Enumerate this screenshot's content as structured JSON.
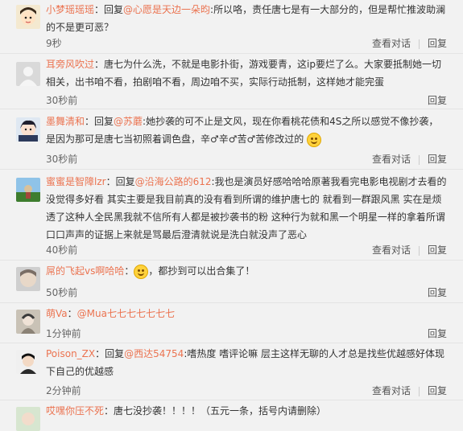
{
  "ops": {
    "view_label": "查看对话",
    "reply_label": "回复"
  },
  "comments": [
    {
      "user": "小梦瑶瑶瑶",
      "prefix": "：回复",
      "mention": "@心愿是天边一朵昀",
      "content": ":所以咯，责任唐七是有一大部分的，但是帮忙推波助澜的不是更可恶？",
      "time": "9秒",
      "has_view": true
    },
    {
      "user": "耳旁风吹过",
      "prefix": "：",
      "mention": "",
      "content": "唐七为什么洗，不就是电影扑街，游戏要青，这ip要烂了么。大家要抵制她一切相关，出书咱不看，拍剧咱不看，周边咱不买，实际行动抵制，这样她才能完蛋",
      "time": "30秒前",
      "has_view": false
    },
    {
      "user": "墨舞清和",
      "prefix": "：回复",
      "mention": "@苏蘑",
      "content": ":她抄袭的可不止是文风，现在你看桃花债和4S之所以感觉不像抄袭，是因为那可是唐七当初照着调色盘，辛♂辛♂苦♂苦修改过的",
      "time": "30秒前",
      "has_view": true
    },
    {
      "user": "蜜蜜是智障lzr",
      "prefix": "：回复",
      "mention": "@沿海公路的612",
      "content": ":我也是演员好感哈哈哈原著我看完电影电视剧才去看的没觉得多好看 其实主要是我目前真的没有看到所谓的维护唐七的 就看到一群跟风黑 实在是烦透了这种人全民黑我就不信所有人都是被抄袭书的粉 这种行为就和黑一个明星一样的拿着所谓口口声声的证据上来就是骂最后澄清就说是洗白就没声了恶心",
      "time": "40秒前",
      "has_view": true
    },
    {
      "user": "屌的飞起vs啊哈哈",
      "prefix": "：",
      "mention": "",
      "content": "，都抄到可以出合集了！",
      "time": "50秒前",
      "has_view": false
    },
    {
      "user": "萌Va",
      "prefix": "：",
      "mention": "@Mua七七七七七七七",
      "content": "",
      "time": "1分钟前",
      "has_view": false
    },
    {
      "user": "Poison_ZX",
      "prefix": "：回复",
      "mention": "@西达54754",
      "content": ":嗜热度 嗜评论嘛 层主这样无聊的人才总是找些优越感好体现下自己的优越感",
      "time": "2分钟前",
      "has_view": true
    },
    {
      "user": "哎嘿你压不死",
      "prefix": "：",
      "mention": "",
      "content": "唐七没抄袭！！！！（五元一条，括号内请删除）",
      "time": "",
      "has_view": false
    }
  ]
}
